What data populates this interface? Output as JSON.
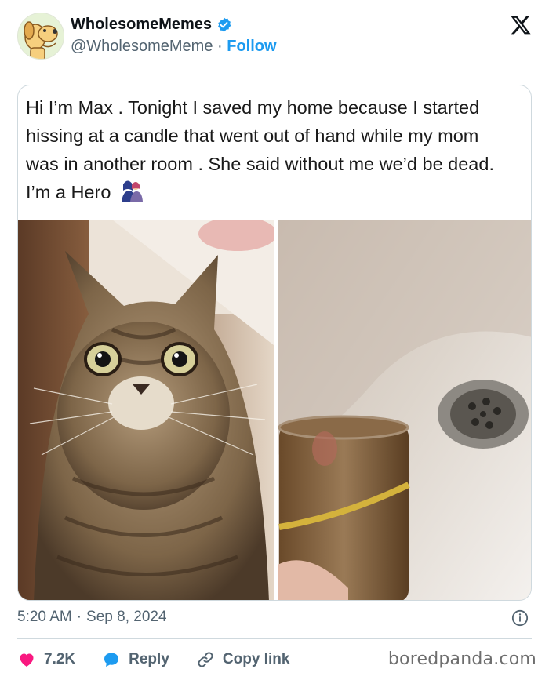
{
  "account": {
    "display_name": "WholesomeMemes",
    "handle": "@WholesomeMeme",
    "separator": " · ",
    "follow_label": "Follow",
    "verified": true,
    "avatar_icon": "cartoon-dog-icon"
  },
  "post": {
    "text": "Hi I’m Max . Tonight I saved my home because I started hissing at a candle that went out of hand while my mom was in another room . She said without me we’d be dead. I’m a Hero",
    "emoji": "couple-emoji"
  },
  "meta": {
    "time": "5:20 AM",
    "separator": "·",
    "date": "Sep 8, 2024"
  },
  "actions": {
    "likes": "7.2K",
    "reply_label": "Reply",
    "copy_label": "Copy link"
  },
  "watermark": "boredpanda.com",
  "colors": {
    "accent": "#1d9bf0",
    "like": "#f91880",
    "text_secondary": "#536471"
  }
}
